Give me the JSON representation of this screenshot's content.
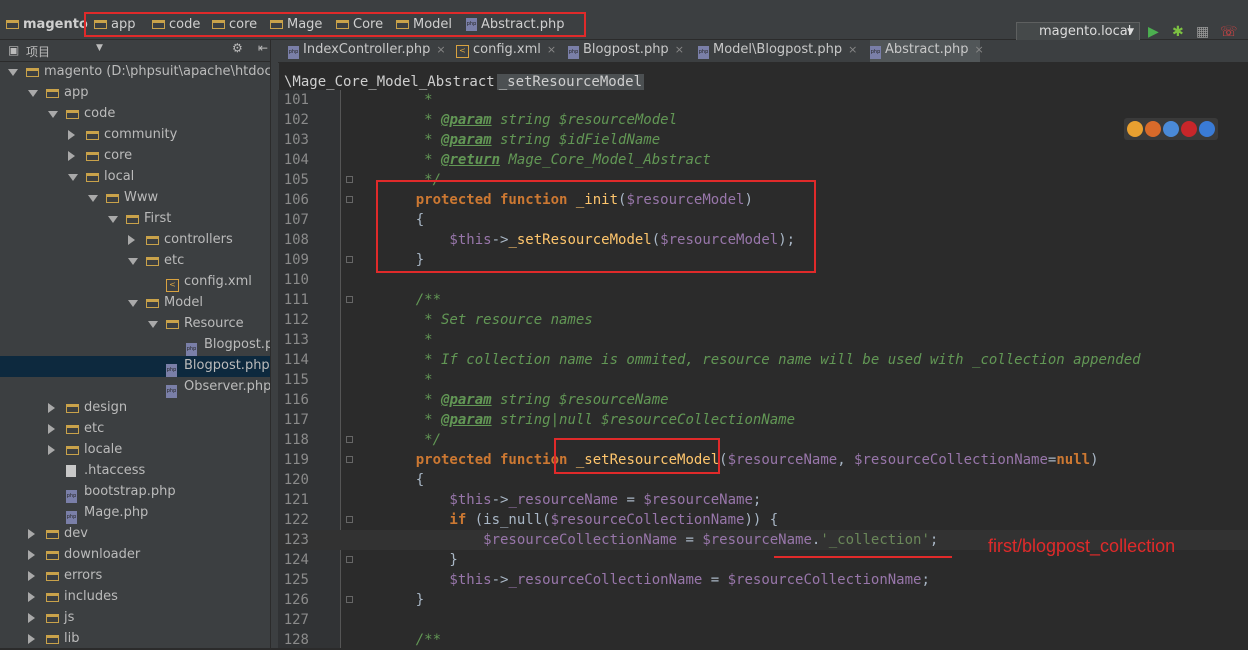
{
  "navbar": {
    "root": "magento",
    "crumbs": [
      "app",
      "code",
      "core",
      "Mage",
      "Core",
      "Model",
      "Abstract.php"
    ],
    "run_config": "magento.local"
  },
  "project_panel": {
    "title": "项目"
  },
  "tree": [
    {
      "label": "magento (D:\\phpsuit\\apache\\htdocs\\mag",
      "depth": 0,
      "kind": "folder",
      "arrow": "down"
    },
    {
      "label": "app",
      "depth": 1,
      "kind": "folder",
      "arrow": "down"
    },
    {
      "label": "code",
      "depth": 2,
      "kind": "folder",
      "arrow": "down"
    },
    {
      "label": "community",
      "depth": 3,
      "kind": "folder",
      "arrow": "right"
    },
    {
      "label": "core",
      "depth": 3,
      "kind": "folder",
      "arrow": "right"
    },
    {
      "label": "local",
      "depth": 3,
      "kind": "folder",
      "arrow": "down"
    },
    {
      "label": "Www",
      "depth": 4,
      "kind": "folder",
      "arrow": "down"
    },
    {
      "label": "First",
      "depth": 5,
      "kind": "folder",
      "arrow": "down"
    },
    {
      "label": "controllers",
      "depth": 6,
      "kind": "folder",
      "arrow": "right"
    },
    {
      "label": "etc",
      "depth": 6,
      "kind": "folder",
      "arrow": "down"
    },
    {
      "label": "config.xml",
      "depth": 7,
      "kind": "xml",
      "arrow": ""
    },
    {
      "label": "Model",
      "depth": 6,
      "kind": "folder",
      "arrow": "down"
    },
    {
      "label": "Resource",
      "depth": 7,
      "kind": "folder",
      "arrow": "down"
    },
    {
      "label": "Blogpost.php",
      "depth": 8,
      "kind": "php",
      "arrow": ""
    },
    {
      "label": "Blogpost.php",
      "depth": 7,
      "kind": "php",
      "arrow": "",
      "selected": true
    },
    {
      "label": "Observer.php",
      "depth": 7,
      "kind": "php",
      "arrow": ""
    },
    {
      "label": "design",
      "depth": 2,
      "kind": "folder",
      "arrow": "right"
    },
    {
      "label": "etc",
      "depth": 2,
      "kind": "folder",
      "arrow": "right"
    },
    {
      "label": "locale",
      "depth": 2,
      "kind": "folder",
      "arrow": "right"
    },
    {
      "label": ".htaccess",
      "depth": 2,
      "kind": "file",
      "arrow": ""
    },
    {
      "label": "bootstrap.php",
      "depth": 2,
      "kind": "php",
      "arrow": ""
    },
    {
      "label": "Mage.php",
      "depth": 2,
      "kind": "php",
      "arrow": ""
    },
    {
      "label": "dev",
      "depth": 1,
      "kind": "folder",
      "arrow": "right"
    },
    {
      "label": "downloader",
      "depth": 1,
      "kind": "folder",
      "arrow": "right"
    },
    {
      "label": "errors",
      "depth": 1,
      "kind": "folder",
      "arrow": "right"
    },
    {
      "label": "includes",
      "depth": 1,
      "kind": "folder",
      "arrow": "right"
    },
    {
      "label": "js",
      "depth": 1,
      "kind": "folder",
      "arrow": "right"
    },
    {
      "label": "lib",
      "depth": 1,
      "kind": "folder",
      "arrow": "right"
    }
  ],
  "tabs": [
    {
      "label": "IndexController.php",
      "icon": "php"
    },
    {
      "label": "config.xml",
      "icon": "xml"
    },
    {
      "label": "Blogpost.php",
      "icon": "php"
    },
    {
      "label": "Model\\Blogpost.php",
      "icon": "php"
    },
    {
      "label": "Abstract.php",
      "icon": "php",
      "active": true
    }
  ],
  "editor_breadcrumb": {
    "class": "\\Mage_Core_Model_Abstract",
    "method": "_setResourceModel"
  },
  "code_lines": [
    {
      "n": "101",
      "segs": [
        [
          "cm",
          "     *"
        ]
      ]
    },
    {
      "n": "102",
      "segs": [
        [
          "cm",
          "     * "
        ],
        [
          "tag",
          "@param"
        ],
        [
          "cm",
          " string $resourceModel"
        ]
      ]
    },
    {
      "n": "103",
      "segs": [
        [
          "cm",
          "     * "
        ],
        [
          "tag",
          "@param"
        ],
        [
          "cm",
          " string $idFieldName"
        ]
      ]
    },
    {
      "n": "104",
      "segs": [
        [
          "cm",
          "     * "
        ],
        [
          "tag",
          "@return"
        ],
        [
          "cm",
          " Mage_Core_Model_Abstract"
        ]
      ]
    },
    {
      "n": "105",
      "segs": [
        [
          "cm",
          "     */"
        ]
      ]
    },
    {
      "n": "106",
      "segs": [
        [
          "kw",
          "    protected function "
        ],
        [
          "fn",
          "_init"
        ],
        [
          "plain",
          "("
        ],
        [
          "var",
          "$resourceModel"
        ],
        [
          "plain",
          ")"
        ]
      ]
    },
    {
      "n": "107",
      "segs": [
        [
          "plain",
          "    {"
        ]
      ]
    },
    {
      "n": "108",
      "segs": [
        [
          "var",
          "        $this"
        ],
        [
          "plain",
          "->"
        ],
        [
          "fn",
          "_setResourceModel"
        ],
        [
          "plain",
          "("
        ],
        [
          "var",
          "$resourceModel"
        ],
        [
          "plain",
          ");"
        ]
      ]
    },
    {
      "n": "109",
      "segs": [
        [
          "plain",
          "    }"
        ]
      ]
    },
    {
      "n": "110",
      "segs": []
    },
    {
      "n": "111",
      "segs": [
        [
          "cm",
          "    /**"
        ]
      ]
    },
    {
      "n": "112",
      "segs": [
        [
          "cm",
          "     * Set resource names"
        ]
      ]
    },
    {
      "n": "113",
      "segs": [
        [
          "cm",
          "     *"
        ]
      ]
    },
    {
      "n": "114",
      "segs": [
        [
          "cm",
          "     * If collection name is ommited, resource name will be used with _collection appended"
        ]
      ]
    },
    {
      "n": "115",
      "segs": [
        [
          "cm",
          "     *"
        ]
      ]
    },
    {
      "n": "116",
      "segs": [
        [
          "cm",
          "     * "
        ],
        [
          "tag",
          "@param"
        ],
        [
          "cm",
          " string $resourceName"
        ]
      ]
    },
    {
      "n": "117",
      "segs": [
        [
          "cm",
          "     * "
        ],
        [
          "tag",
          "@param"
        ],
        [
          "cm",
          " string|null $resourceCollectionName"
        ]
      ]
    },
    {
      "n": "118",
      "segs": [
        [
          "cm",
          "     */"
        ]
      ]
    },
    {
      "n": "119",
      "segs": [
        [
          "kw",
          "    protected function "
        ],
        [
          "fn",
          "_setResourceModel"
        ],
        [
          "plain",
          "("
        ],
        [
          "var",
          "$resourceName"
        ],
        [
          "plain",
          ", "
        ],
        [
          "var",
          "$resourceCollectionName"
        ],
        [
          "plain",
          "="
        ],
        [
          "kw",
          "null"
        ],
        [
          "plain",
          ")"
        ]
      ]
    },
    {
      "n": "120",
      "segs": [
        [
          "plain",
          "    {"
        ]
      ]
    },
    {
      "n": "121",
      "segs": [
        [
          "var",
          "        $this"
        ],
        [
          "plain",
          "->"
        ],
        [
          "var",
          "_resourceName"
        ],
        [
          "plain",
          " = "
        ],
        [
          "var",
          "$resourceName"
        ],
        [
          "plain",
          ";"
        ]
      ]
    },
    {
      "n": "122",
      "segs": [
        [
          "kw",
          "        if "
        ],
        [
          "plain",
          "(is_null("
        ],
        [
          "var",
          "$resourceCollectionName"
        ],
        [
          "plain",
          ")) {"
        ]
      ]
    },
    {
      "n": "123",
      "segs": [
        [
          "var",
          "            $resourceCollectionName"
        ],
        [
          "plain",
          " = "
        ],
        [
          "var",
          "$resourceName"
        ],
        [
          "plain",
          "."
        ],
        [
          "str",
          "'_collection'"
        ],
        [
          "plain",
          ";"
        ]
      ],
      "highlight": true
    },
    {
      "n": "124",
      "segs": [
        [
          "plain",
          "        }"
        ]
      ]
    },
    {
      "n": "125",
      "segs": [
        [
          "var",
          "        $this"
        ],
        [
          "plain",
          "->"
        ],
        [
          "var",
          "_resourceCollectionName"
        ],
        [
          "plain",
          " = "
        ],
        [
          "var",
          "$resourceCollectionName"
        ],
        [
          "plain",
          ";"
        ]
      ]
    },
    {
      "n": "126",
      "segs": [
        [
          "plain",
          "    }"
        ]
      ]
    },
    {
      "n": "127",
      "segs": []
    },
    {
      "n": "128",
      "segs": [
        [
          "cm",
          "    /**"
        ]
      ]
    }
  ],
  "annotation": "first/blogpost_collection"
}
